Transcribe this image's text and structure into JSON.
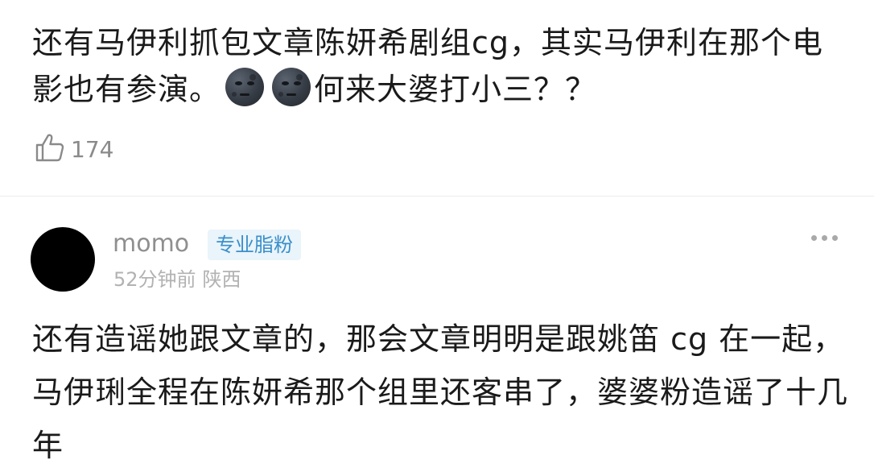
{
  "post": {
    "text_part1": "还有马伊利抓包文章陈妍希剧组cg，其实马伊利在那个电影也有参演。",
    "emoji_1": "new-moon-face-icon",
    "emoji_2": "new-moon-face-icon",
    "text_part2": "何来大婆打小三？？",
    "like_count": "174"
  },
  "reply": {
    "username": "momo",
    "badge": "专业脂粉",
    "time": "52分钟前",
    "location": "陕西",
    "text": "还有造谣她跟文章的，那会文章明明是跟姚笛 cg 在一起，马伊琍全程在陈妍希那个组里还客串了，婆婆粉造谣了十几年"
  },
  "colors": {
    "text": "#1a1a1a",
    "muted": "#8f8f8f",
    "badge_bg": "#e9f4fb",
    "badge_text": "#3a8fc9",
    "avatar": "#000000"
  }
}
